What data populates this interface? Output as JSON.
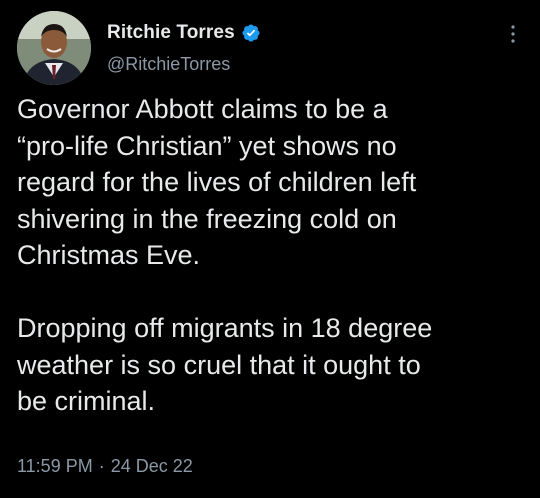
{
  "tweet": {
    "author": {
      "display_name": "Ritchie Torres",
      "handle": "@RitchieTorres",
      "verified": true
    },
    "text": "Governor Abbott claims to be a\n“pro-life Christian” yet shows no\nregard for the lives of children left\nshivering in the freezing cold on\nChristmas Eve.\n\nDropping off migrants in 18 degree\nweather is so cruel that it ought to\nbe criminal.",
    "time": "11:59 PM",
    "separator": "·",
    "date": "24 Dec 22"
  },
  "icons": {
    "verified_badge": "verified-badge-icon",
    "more_options": "more-vertical-icon"
  },
  "colors": {
    "background": "#000000",
    "primary_text": "#e7e9ea",
    "secondary_text": "#8b98a5",
    "verified_blue": "#1d9bf0"
  }
}
